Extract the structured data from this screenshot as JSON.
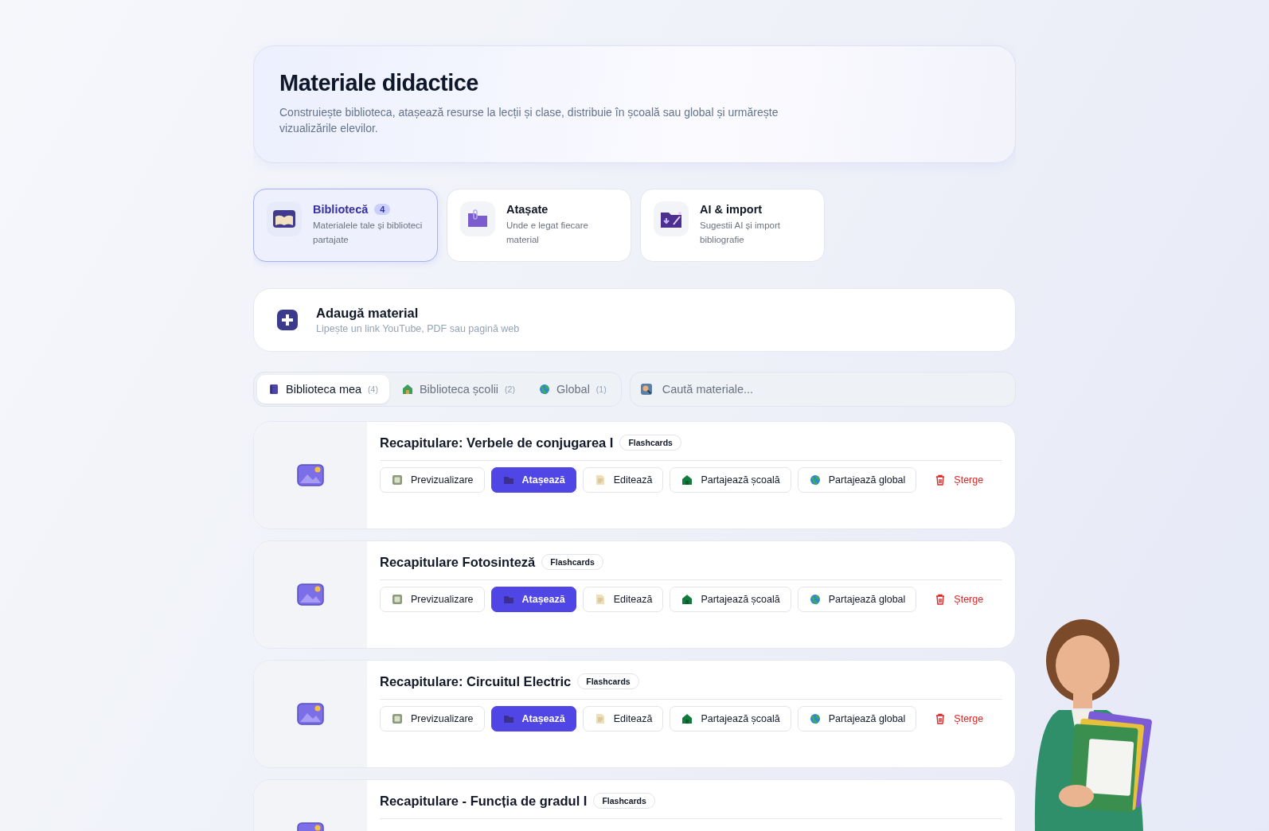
{
  "header": {
    "title": "Materiale didactice",
    "subtitle": "Construiește biblioteca, atașează resurse la lecții și clase, distribuie în școală sau global și urmărește vizualizările elevilor."
  },
  "sections": [
    {
      "kind": "library",
      "title": "Bibliotecă",
      "badge": "4",
      "description": "Materialele tale și biblioteci partajate",
      "selected": true
    },
    {
      "kind": "attached",
      "title": "Atașate",
      "description": "Unde e legat fiecare material",
      "selected": false
    },
    {
      "kind": "ai",
      "title": "AI & import",
      "description": "Sugestii AI și import bibliografie",
      "selected": false
    }
  ],
  "add_material": {
    "title": "Adaugă material",
    "subtitle": "Lipește un link YouTube, PDF sau pagină web"
  },
  "library_tabs": [
    {
      "kind": "mine",
      "label": "Biblioteca mea",
      "count": "(4)",
      "selected": true
    },
    {
      "kind": "school",
      "label": "Biblioteca școlii",
      "count": "(2)",
      "selected": false
    },
    {
      "kind": "global",
      "label": "Global",
      "count": "(1)",
      "selected": false
    }
  ],
  "search": {
    "placeholder": "Caută materiale..."
  },
  "materials": [
    {
      "title": "Recapitulare: Verbele de conjugarea I",
      "tag": "Flashcards",
      "actions": [
        {
          "kind": "preview",
          "label": "Previzualizare"
        },
        {
          "kind": "attach",
          "label": "Atașează"
        },
        {
          "kind": "edit",
          "label": "Editează"
        },
        {
          "kind": "share-school",
          "label": "Partajează școală"
        },
        {
          "kind": "share-global",
          "label": "Partajează global"
        },
        {
          "kind": "delete",
          "label": "Șterge"
        }
      ]
    },
    {
      "title": "Recapitulare Fotosinteză",
      "tag": "Flashcards",
      "actions": [
        {
          "kind": "preview",
          "label": "Previzualizare"
        },
        {
          "kind": "attach",
          "label": "Atașează"
        },
        {
          "kind": "edit",
          "label": "Editează"
        },
        {
          "kind": "share-school",
          "label": "Partajează școală"
        },
        {
          "kind": "share-global",
          "label": "Partajează global"
        },
        {
          "kind": "delete",
          "label": "Șterge"
        }
      ]
    },
    {
      "title": "Recapitulare: Circuitul Electric",
      "tag": "Flashcards",
      "actions": [
        {
          "kind": "preview",
          "label": "Previzualizare"
        },
        {
          "kind": "attach",
          "label": "Atașează"
        },
        {
          "kind": "edit",
          "label": "Editează"
        },
        {
          "kind": "share-school",
          "label": "Partajează școală"
        },
        {
          "kind": "share-global",
          "label": "Partajează global"
        },
        {
          "kind": "delete",
          "label": "Șterge"
        }
      ]
    },
    {
      "title": "Recapitulare - Funcția de gradul I",
      "tag": "Flashcards"
    }
  ]
}
